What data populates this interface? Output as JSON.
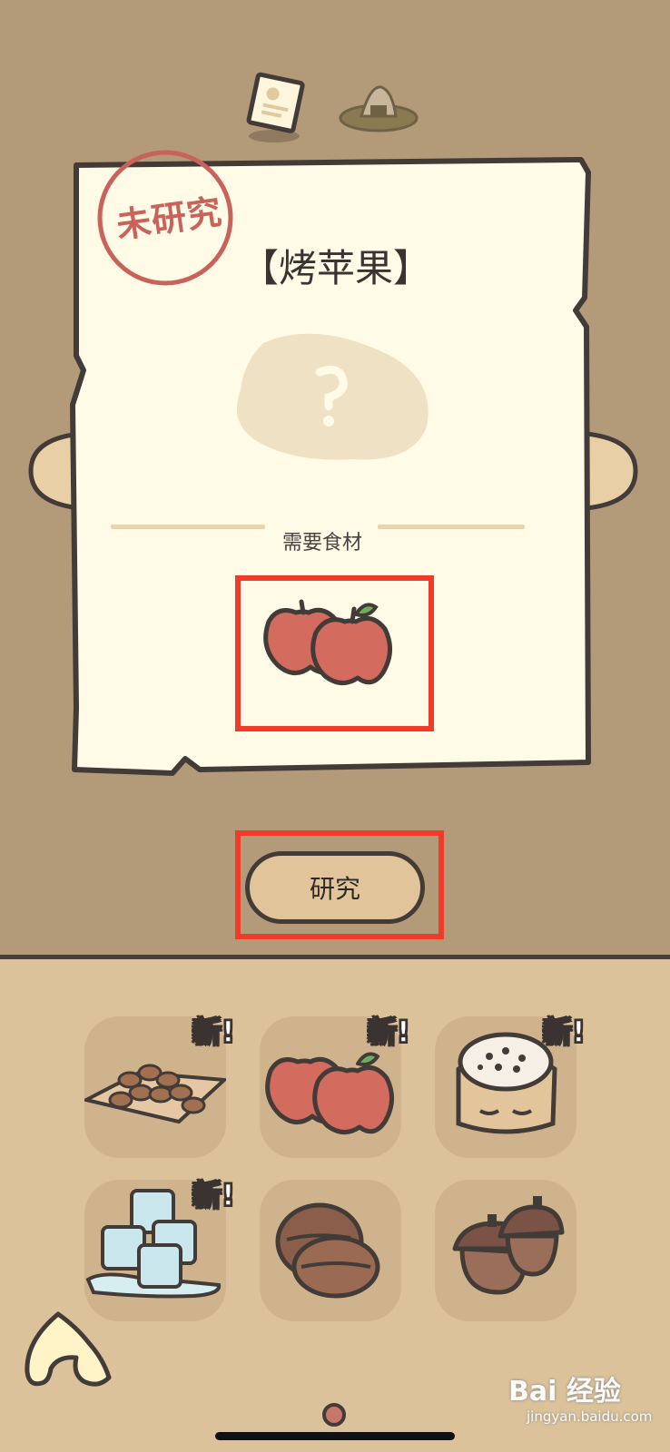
{
  "top_tabs": [
    {
      "icon": "recipe-card-icon",
      "active": true
    },
    {
      "icon": "rice-ball-icon",
      "active": false
    }
  ],
  "recipe": {
    "stamp": "未研究",
    "title": "【烤苹果】",
    "image_placeholder": "?",
    "ingredients_label": "需要食材",
    "ingredients": [
      {
        "icon": "apple-icon"
      }
    ]
  },
  "research_button": {
    "label": "研究"
  },
  "inventory": [
    {
      "icon": "almonds-icon",
      "badge": "新!"
    },
    {
      "icon": "apple-icon",
      "badge": "新!"
    },
    {
      "icon": "flour-sack-icon",
      "badge": "新!"
    },
    {
      "icon": "ice-cubes-icon",
      "badge": "新!"
    },
    {
      "icon": "walnut-icon",
      "badge": ""
    },
    {
      "icon": "acorn-icon",
      "badge": ""
    }
  ],
  "back_button": {
    "icon": "back-arrow-icon"
  },
  "watermark": {
    "text": "Bai 经验",
    "sub": "jingyan.baidu.com"
  },
  "colors": {
    "background": "#b39a78",
    "paper": "#fffbe6",
    "highlight": "#f03a2a",
    "stamp": "#c9625a",
    "inventory_bg": "#dbc29a"
  }
}
